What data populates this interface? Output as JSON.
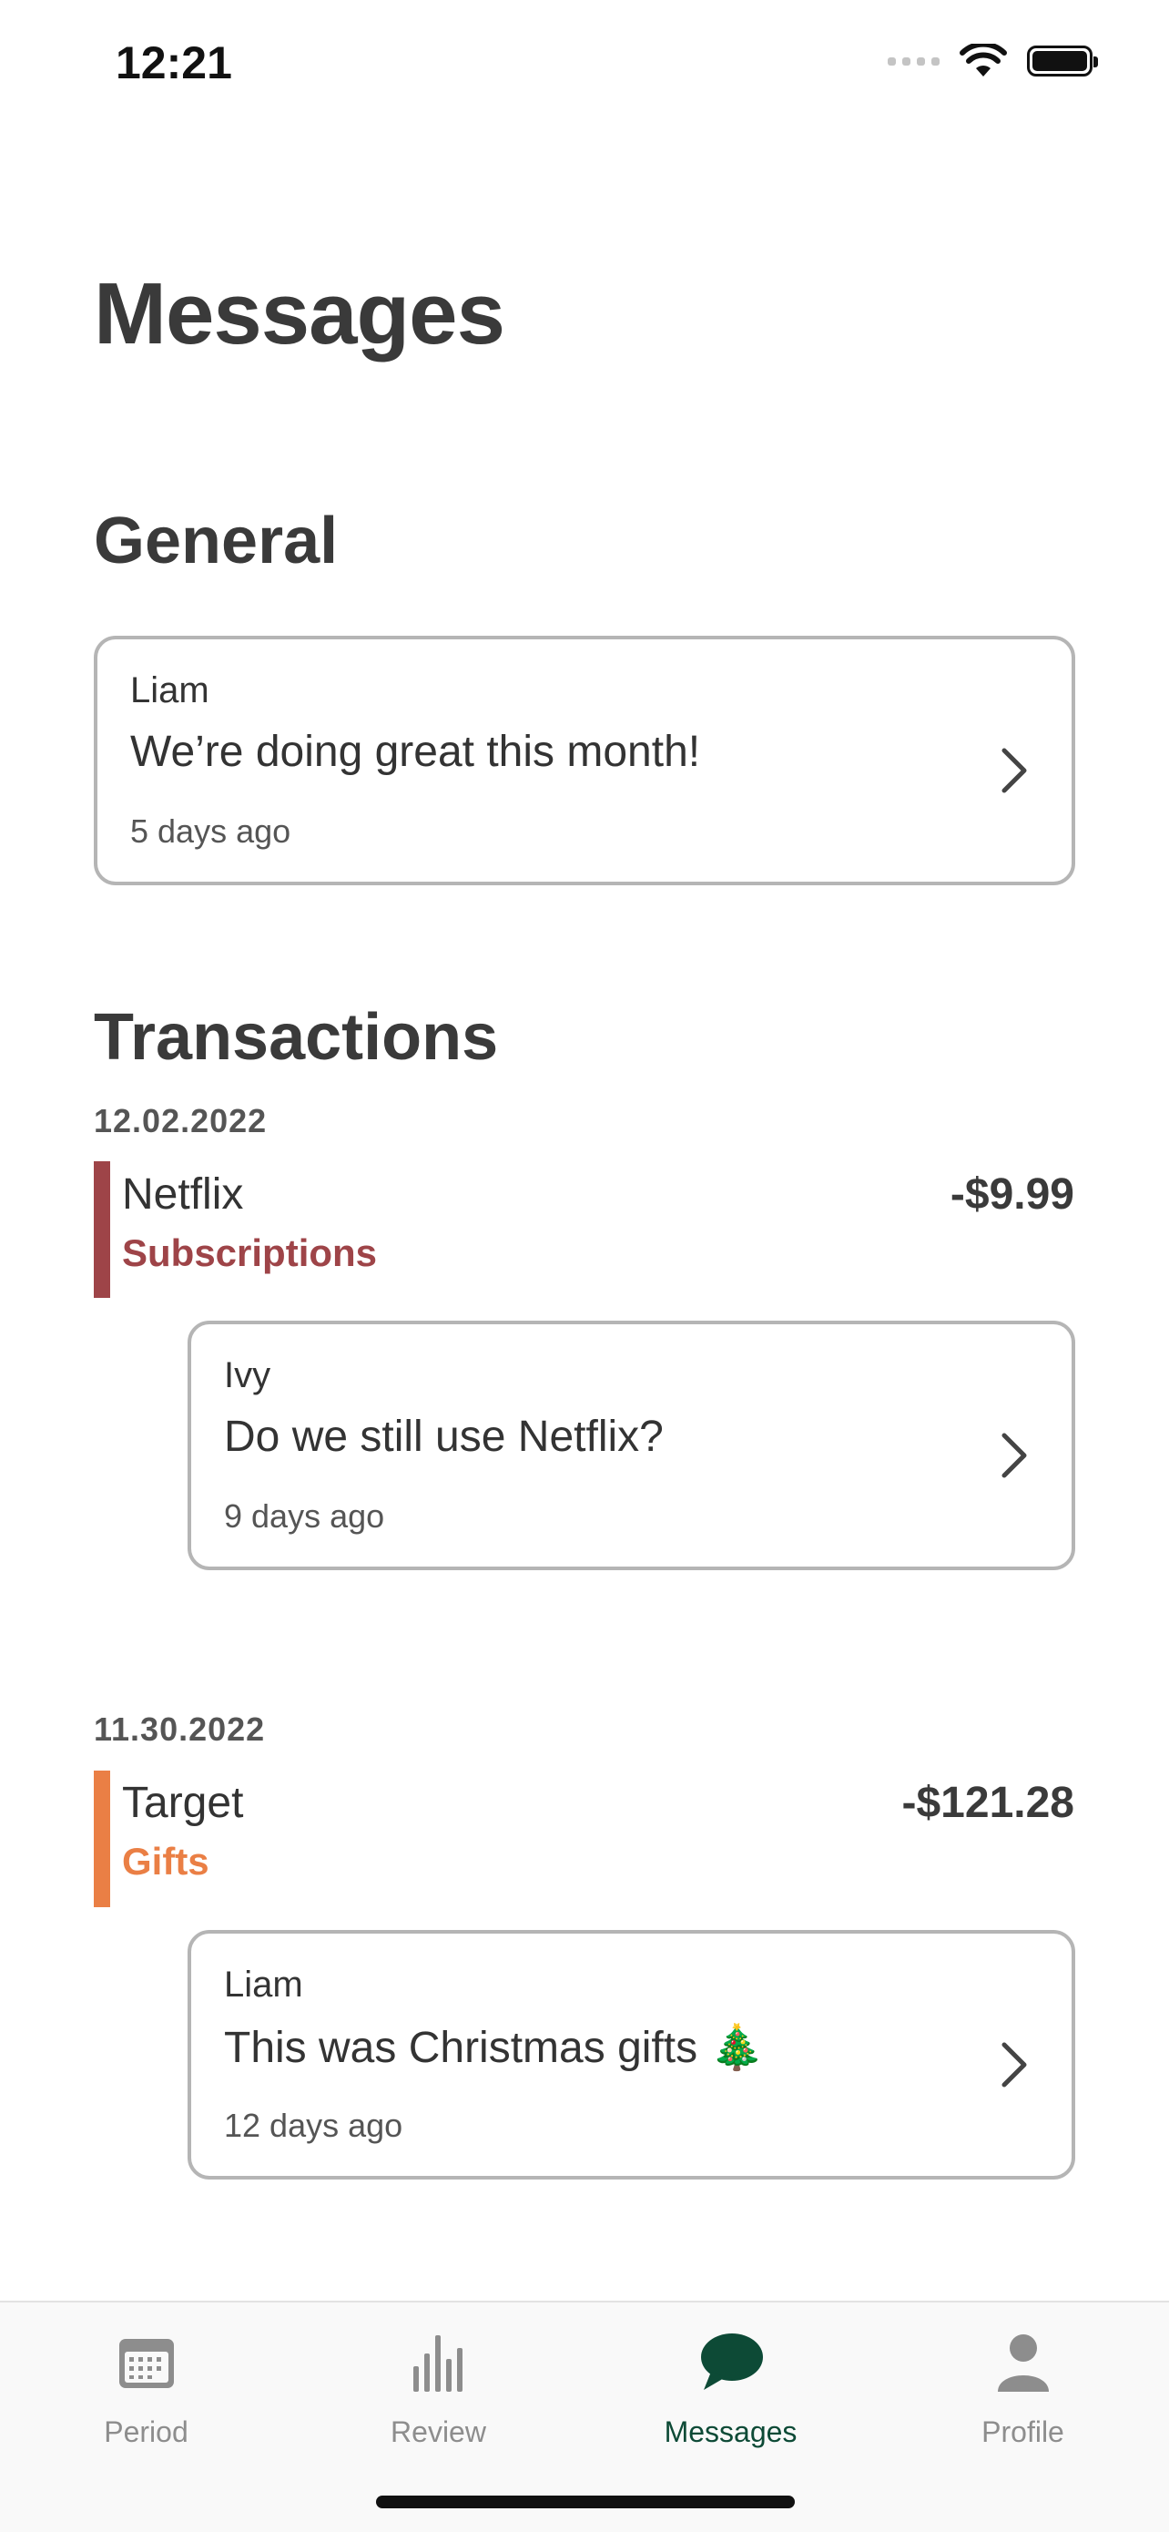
{
  "status": {
    "time": "12:21"
  },
  "page": {
    "title": "Messages"
  },
  "general": {
    "title": "General",
    "messages": [
      {
        "author": "Liam",
        "text": "We’re doing great this month!",
        "ago": "5 days ago"
      }
    ]
  },
  "transactions": {
    "title": "Transactions",
    "items": [
      {
        "date": "12.02.2022",
        "merchant": "Netflix",
        "category": "Subscriptions",
        "amount": "-$9.99",
        "category_color": "#9e4448",
        "message": {
          "author": "Ivy",
          "text": "Do we still use Netflix?",
          "ago": "9 days ago"
        }
      },
      {
        "date": "11.30.2022",
        "merchant": "Target",
        "category": "Gifts",
        "amount": "-$121.28",
        "category_color": "#ea7f45",
        "message": {
          "author": "Liam",
          "text": "This was Christmas gifts 🎄",
          "ago": "12 days ago"
        }
      }
    ]
  },
  "tabs": [
    {
      "label": "Period",
      "icon": "calendar-icon"
    },
    {
      "label": "Review",
      "icon": "bar-chart-icon"
    },
    {
      "label": "Messages",
      "icon": "chat-bubble-icon",
      "active": true
    },
    {
      "label": "Profile",
      "icon": "person-icon"
    }
  ],
  "colors": {
    "accent": "#0d4a36",
    "inactive_tab": "#8d8d8d",
    "card_border": "#b5b5b5"
  }
}
